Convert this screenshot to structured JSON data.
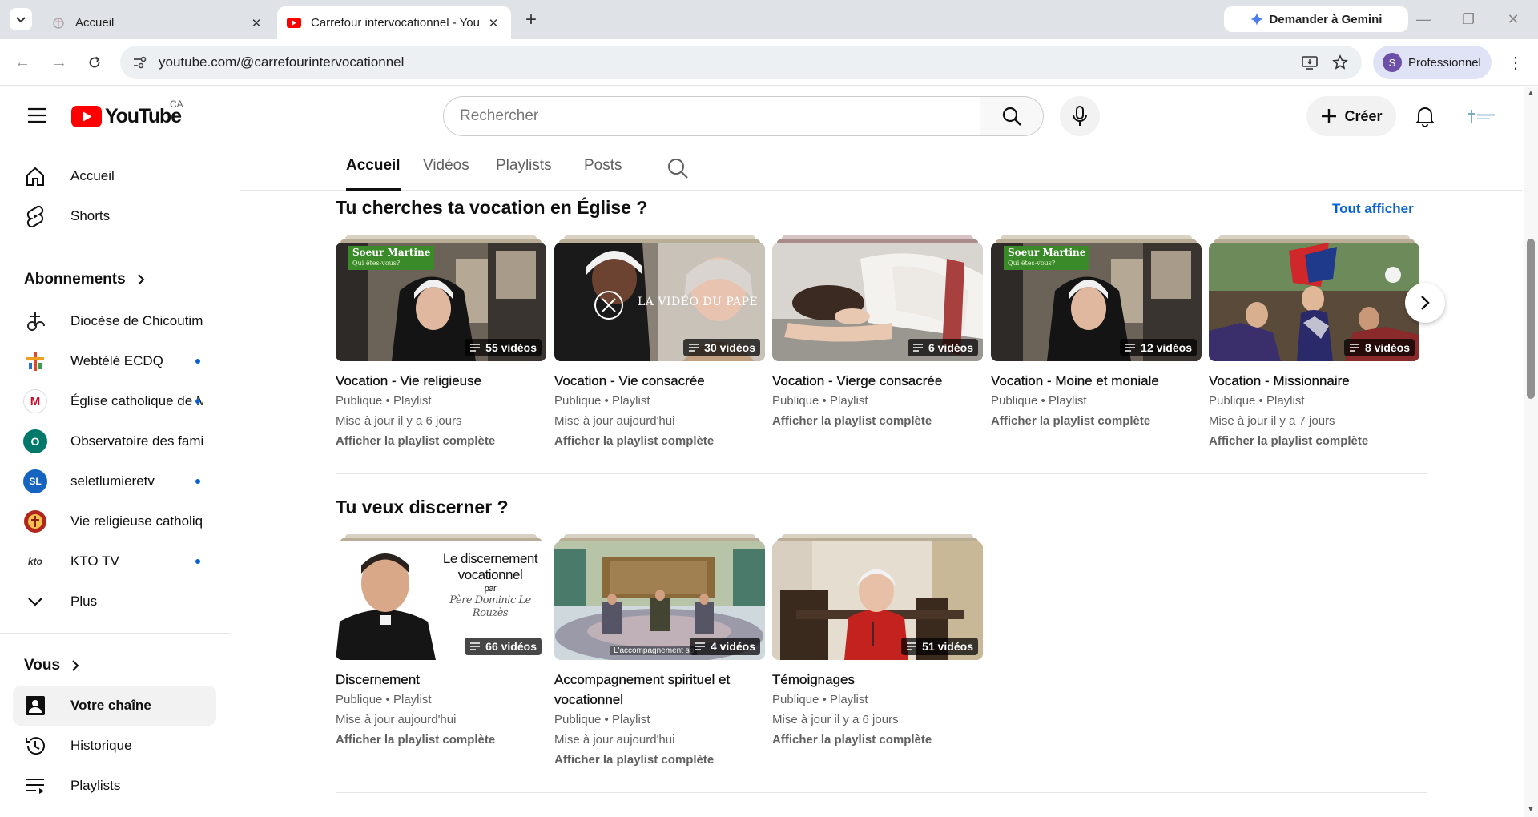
{
  "browser": {
    "tabs": [
      {
        "title": "Accueil"
      },
      {
        "title": "Carrefour intervocationnel - You"
      }
    ],
    "gemini_label": "Demander à Gemini",
    "url": "youtube.com/@carrefourintervocationnel",
    "profile_label": "Professionnel",
    "profile_initial": "S"
  },
  "masthead": {
    "logo_text": "YouTube",
    "region": "CA",
    "search_placeholder": "Rechercher",
    "create_label": "Créer"
  },
  "sidebar": {
    "main": [
      {
        "label": "Accueil",
        "icon": "home-icon"
      },
      {
        "label": "Shorts",
        "icon": "shorts-icon"
      }
    ],
    "subscriptions_title": "Abonnements",
    "subscriptions": [
      {
        "label": "Diocèse de Chicoutimi",
        "new": false
      },
      {
        "label": "Webtélé ECDQ",
        "new": true
      },
      {
        "label": "Église catholique de Montréal",
        "new": true
      },
      {
        "label": "Observatoire des familles",
        "new": false,
        "initial": "O"
      },
      {
        "label": "seletlumieretv",
        "new": true
      },
      {
        "label": "Vie religieuse catholique",
        "new": false
      },
      {
        "label": "KTO TV",
        "new": true
      }
    ],
    "more_label": "Plus",
    "you_title": "Vous",
    "you": [
      {
        "label": "Votre chaîne",
        "icon": "channel-icon"
      },
      {
        "label": "Historique",
        "icon": "history-icon"
      },
      {
        "label": "Playlists",
        "icon": "playlists-icon"
      }
    ]
  },
  "channel_tabs": [
    "Accueil",
    "Vidéos",
    "Playlists",
    "Posts"
  ],
  "shelves": [
    {
      "title": "Tu cherches ta vocation en Église ?",
      "see_all": "Tout afficher",
      "playlists": [
        {
          "title": "Vocation - Vie religieuse",
          "count": "55 vidéos",
          "visibility": "Publique",
          "type": "Playlist",
          "updated": "Mise à jour il y a 6 jours",
          "link": "Afficher la playlist complète"
        },
        {
          "title": "Vocation - Vie consacrée",
          "count": "30 vidéos",
          "visibility": "Publique",
          "type": "Playlist",
          "updated": "Mise à jour aujourd'hui",
          "link": "Afficher la playlist complète"
        },
        {
          "title": "Vocation - Vierge consacrée",
          "count": "6 vidéos",
          "visibility": "Publique",
          "type": "Playlist",
          "updated": "",
          "link": "Afficher la playlist complète"
        },
        {
          "title": "Vocation - Moine et moniale",
          "count": "12 vidéos",
          "visibility": "Publique",
          "type": "Playlist",
          "updated": "",
          "link": "Afficher la playlist complète"
        },
        {
          "title": "Vocation - Missionnaire",
          "count": "8 vidéos",
          "visibility": "Publique",
          "type": "Playlist",
          "updated": "Mise à jour il y a 7 jours",
          "link": "Afficher la playlist complète"
        }
      ]
    },
    {
      "title": "Tu veux discerner ?",
      "playlists": [
        {
          "title": "Discernement",
          "count": "66 vidéos",
          "visibility": "Publique",
          "type": "Playlist",
          "updated": "Mise à jour aujourd'hui",
          "link": "Afficher la playlist complète"
        },
        {
          "title": "Accompagnement spirituel et vocationnel",
          "count": "4 vidéos",
          "visibility": "Publique",
          "type": "Playlist",
          "updated": "Mise à jour aujourd'hui",
          "link": "Afficher la playlist complète"
        },
        {
          "title": "Témoignages",
          "count": "51 vidéos",
          "visibility": "Publique",
          "type": "Playlist",
          "updated": "Mise à jour il y a 6 jours",
          "link": "Afficher la playlist complète"
        }
      ]
    }
  ],
  "thumb_text": {
    "soeur_martine": "Soeur Martine",
    "soeur_martine_sub": "Qui êtes-vous?",
    "video_pape": "LA VIDÉO DU PAPE",
    "discernement_line1": "Le discernement",
    "discernement_line2": "vocationnel",
    "discernement_by": "par",
    "discernement_author": "Père Dominic Le Rouzès",
    "accompagnement_caption": "L'accompagnement sp"
  },
  "colors": {
    "brand_red": "#ff0000",
    "link_blue": "#065fd4",
    "new_dot": "#065fd4"
  }
}
